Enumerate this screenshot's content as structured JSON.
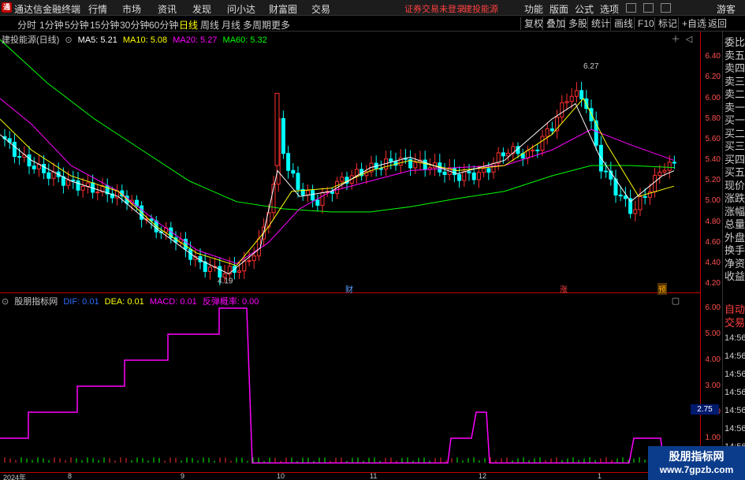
{
  "menubar": {
    "title": "通达信金融终端",
    "items": [
      "行情",
      "市场",
      "资讯",
      "发现",
      "问小达",
      "财富圈",
      "交易"
    ],
    "notice_left": "证券交易未登录",
    "notice_right": "建投能源",
    "right_items": [
      "功能",
      "版面",
      "公式",
      "选项"
    ],
    "guest": "游客"
  },
  "toolbar": {
    "periods": [
      "分时",
      "1分钟",
      "5分钟",
      "15分钟",
      "30分钟",
      "60分钟",
      "日线",
      "周线",
      "月线",
      "多周期",
      "更多"
    ],
    "active_period": "日线",
    "buttons": [
      "复权",
      "叠加",
      "多股",
      "统计",
      "画线",
      "F10",
      "标记",
      "+自选",
      "返回"
    ]
  },
  "main_chart": {
    "stock_label": "建投能源(日线)",
    "ma5": "MA5: 5.21",
    "ma10": "MA10: 5.08",
    "ma20": "MA20: 5.27",
    "ma60": "MA60: 5.32",
    "high_marker": "6.27",
    "low_marker": "4.19",
    "event_tags": [
      "财",
      "涨",
      "预"
    ],
    "colors": {
      "up": "#ff3030",
      "down": "#00ffff",
      "ma5": "#ffffff",
      "ma10": "#ffff00",
      "ma20": "#ff00ff",
      "ma60": "#00ff00"
    }
  },
  "indicator": {
    "name": "股朋指标网",
    "dif": "DIF: 0.01",
    "dea": "DEA: 0.01",
    "macd": "MACD: 0.01",
    "signal": "反弹概率: 0.00"
  },
  "yaxis": {
    "price_ticks": [
      "6.40",
      "6.20",
      "6.00",
      "5.80",
      "5.60",
      "5.40",
      "5.20",
      "5.00",
      "4.80",
      "4.60",
      "4.40",
      "4.20"
    ],
    "ind_ticks": [
      "6.00",
      "5.00",
      "4.00",
      "3.00",
      "2.00",
      "1.00"
    ],
    "current_box": "2.75"
  },
  "side_panel": {
    "top_label": "委比",
    "labels": [
      "委比",
      "卖五",
      "卖四",
      "卖三",
      "卖二",
      "卖一",
      "买一",
      "买二",
      "买三",
      "买四",
      "买五",
      "现价",
      "涨跌",
      "涨幅",
      "总量",
      "外盘",
      "换手",
      "净资",
      "收益"
    ],
    "lower_labels": [
      "自动",
      "交易"
    ],
    "times": [
      "14:56",
      "14:56",
      "14:56",
      "14:56",
      "14:56",
      "14:56",
      "14:56",
      "14:56"
    ]
  },
  "dateaxis": {
    "ticks": [
      "2024年",
      "8",
      "9",
      "10",
      "11",
      "12",
      "1"
    ]
  },
  "watermark": {
    "line1": "股朋指标网",
    "line2": "www.7gpzb.com"
  }
}
